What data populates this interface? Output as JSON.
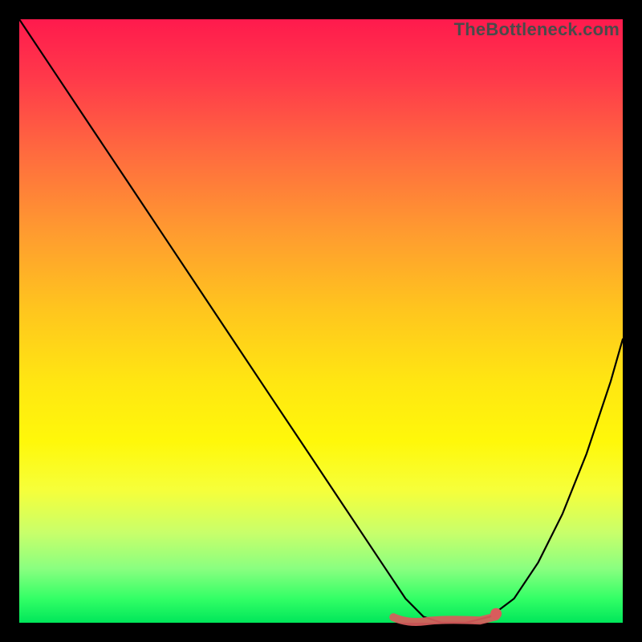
{
  "watermark": "TheBottleneck.com",
  "chart_data": {
    "type": "line",
    "title": "",
    "xlabel": "",
    "ylabel": "",
    "xlim": [
      0,
      100
    ],
    "ylim": [
      0,
      100
    ],
    "background_gradient": {
      "orientation": "vertical",
      "stops": [
        {
          "pos": 0,
          "color": "#ff1a4d"
        },
        {
          "pos": 22,
          "color": "#ff6a3f"
        },
        {
          "pos": 48,
          "color": "#ffc51e"
        },
        {
          "pos": 70,
          "color": "#fff80a"
        },
        {
          "pos": 91,
          "color": "#8aff80"
        },
        {
          "pos": 100,
          "color": "#00e65a"
        }
      ]
    },
    "series": [
      {
        "name": "bottleneck-curve",
        "x": [
          0,
          6,
          12,
          18,
          24,
          30,
          36,
          42,
          48,
          54,
          60,
          64,
          67,
          70,
          74,
          78,
          82,
          86,
          90,
          94,
          98,
          100
        ],
        "values": [
          100,
          91,
          82,
          73,
          64,
          55,
          46,
          37,
          28,
          19,
          10,
          4,
          1,
          0,
          0,
          1,
          4,
          10,
          18,
          28,
          40,
          47
        ],
        "color": "#000000"
      }
    ],
    "annotations": [
      {
        "name": "trough-highlight",
        "type": "segment",
        "x_start": 62,
        "x_end": 79,
        "y": 0.5,
        "color": "#d95c5c"
      },
      {
        "name": "trough-end-dot",
        "type": "point",
        "x": 79,
        "y": 1.5,
        "color": "#d95c5c"
      }
    ]
  }
}
